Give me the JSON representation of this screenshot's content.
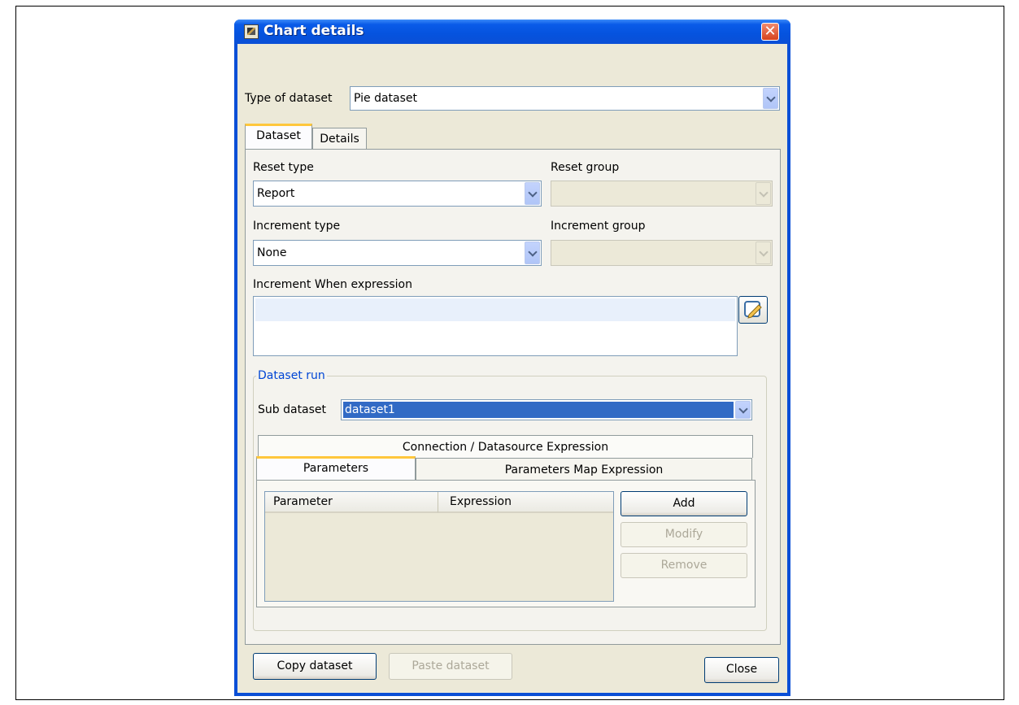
{
  "window": {
    "title": "Chart details",
    "close_label": "Close"
  },
  "type_of_dataset": {
    "label": "Type of dataset",
    "value": "Pie dataset"
  },
  "tabs": [
    {
      "label": "Dataset",
      "active": true
    },
    {
      "label": "Details",
      "active": false
    }
  ],
  "dataset_tab": {
    "reset_type": {
      "label": "Reset type",
      "value": "Report"
    },
    "reset_group": {
      "label": "Reset group",
      "value": ""
    },
    "increment_type": {
      "label": "Increment type",
      "value": "None"
    },
    "increment_group": {
      "label": "Increment group",
      "value": ""
    },
    "increment_when": {
      "label": "Increment When expression",
      "value": ""
    },
    "dataset_run": {
      "legend": "Dataset run",
      "sub_dataset_label": "Sub dataset",
      "sub_dataset_value": "dataset1",
      "connection_tab": "Connection / Datasource Expression",
      "parameters_tab": "Parameters",
      "parameters_map_tab": "Parameters Map Expression",
      "table": {
        "columns": [
          "Parameter",
          "Expression"
        ],
        "rows": []
      },
      "add_label": "Add",
      "modify_label": "Modify",
      "remove_label": "Remove"
    },
    "copy_label": "Copy dataset",
    "paste_label": "Paste dataset"
  },
  "colors": {
    "title_bar": "#0a4fd6",
    "dialog_bg": "#ece9d8",
    "selection": "#316ac5",
    "group_legend": "#0046d5",
    "active_tab_accent": "#ffc73c"
  }
}
